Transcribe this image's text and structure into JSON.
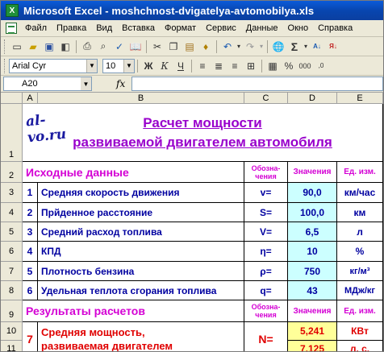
{
  "window": {
    "title": "Microsoft Excel - moshchnost-dvigatelya-avtomobilya.xls"
  },
  "menu": [
    "Файл",
    "Правка",
    "Вид",
    "Вставка",
    "Формат",
    "Сервис",
    "Данные",
    "Окно",
    "Справка"
  ],
  "format_toolbar": {
    "font": "Arial Cyr",
    "size": "10"
  },
  "formula_bar": {
    "name_box": "A20",
    "fx": "fx",
    "value": ""
  },
  "columns": [
    "A",
    "B",
    "C",
    "D",
    "E"
  ],
  "rows": [
    "1",
    "2",
    "3",
    "4",
    "5",
    "6",
    "7",
    "8",
    "9",
    "10",
    "11"
  ],
  "sheet": {
    "brand": "al-vo.ru",
    "title_line1": "Расчет мощности",
    "title_line2": "развиваемой двигателем автомобиля",
    "inputs_header": "Исходные данные",
    "results_header": "Результаты расчетов",
    "col_designation": "Обозна-чения",
    "col_values": "Значения",
    "col_units": "Ед. изм.",
    "inputs": [
      {
        "n": "1",
        "label": "Средняя скорость движения",
        "symbol": "v=",
        "value": "90,0",
        "unit": "км/час"
      },
      {
        "n": "2",
        "label": "Прйденное расстояние",
        "symbol": "S=",
        "value": "100,0",
        "unit": "км"
      },
      {
        "n": "3",
        "label": "Средний расход топлива",
        "symbol": "V=",
        "value": "6,5",
        "unit": "л"
      },
      {
        "n": "4",
        "label": "КПД",
        "symbol": "η=",
        "value": "10",
        "unit": "%"
      },
      {
        "n": "5",
        "label": "Плотность бензина",
        "symbol": "ρ=",
        "value": "750",
        "unit": "кг/м³"
      },
      {
        "n": "6",
        "label": "Удельная теплота сгорания топлива",
        "symbol": "q=",
        "value": "43",
        "unit": "МДж/кг"
      }
    ],
    "result": {
      "n": "7",
      "label": "Средняя мощность, развиваемая двигателем",
      "symbol": "N=",
      "value_kw": "5,241",
      "unit_kw": "КВт",
      "value_hp": "7,125",
      "unit_hp": "л. с."
    }
  }
}
